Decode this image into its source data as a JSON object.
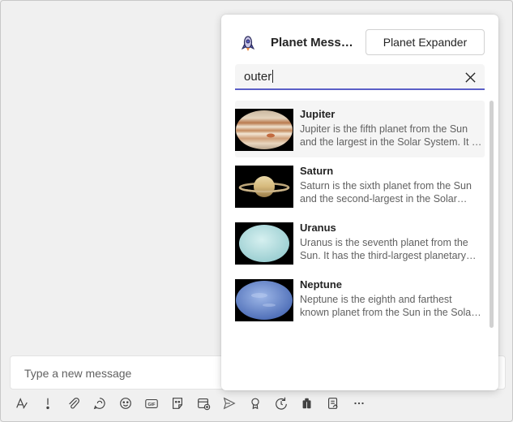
{
  "popup": {
    "app_title": "Planet Messaging Extension",
    "expander_button": "Planet Expander",
    "search": {
      "value": "outer"
    },
    "results": [
      {
        "title": "Jupiter",
        "description": "Jupiter is the fifth planet from the Sun and the largest in the Solar System. It is a gas giant.",
        "thumb": "jupiter"
      },
      {
        "title": "Saturn",
        "description": "Saturn is the sixth planet from the Sun and the second-largest in the Solar System.",
        "thumb": "saturn"
      },
      {
        "title": "Uranus",
        "description": "Uranus is the seventh planet from the Sun. It has the third-largest planetary radius.",
        "thumb": "uranus"
      },
      {
        "title": "Neptune",
        "description": "Neptune is the eighth and farthest known planet from the Sun in the Solar System.",
        "thumb": "neptune"
      }
    ]
  },
  "compose": {
    "placeholder": "Type a new message"
  },
  "toolbar": {
    "icons": [
      "format-icon",
      "important-icon",
      "attach-icon",
      "loop-icon",
      "emoji-icon",
      "gif-icon",
      "sticker-icon",
      "schedule-meeting-icon",
      "send-icon",
      "praise-icon",
      "updates-icon",
      "apps-icon",
      "approvals-icon",
      "more-icon"
    ]
  },
  "colors": {
    "accent": "#5b5fc7",
    "background": "#f0f0f0"
  }
}
